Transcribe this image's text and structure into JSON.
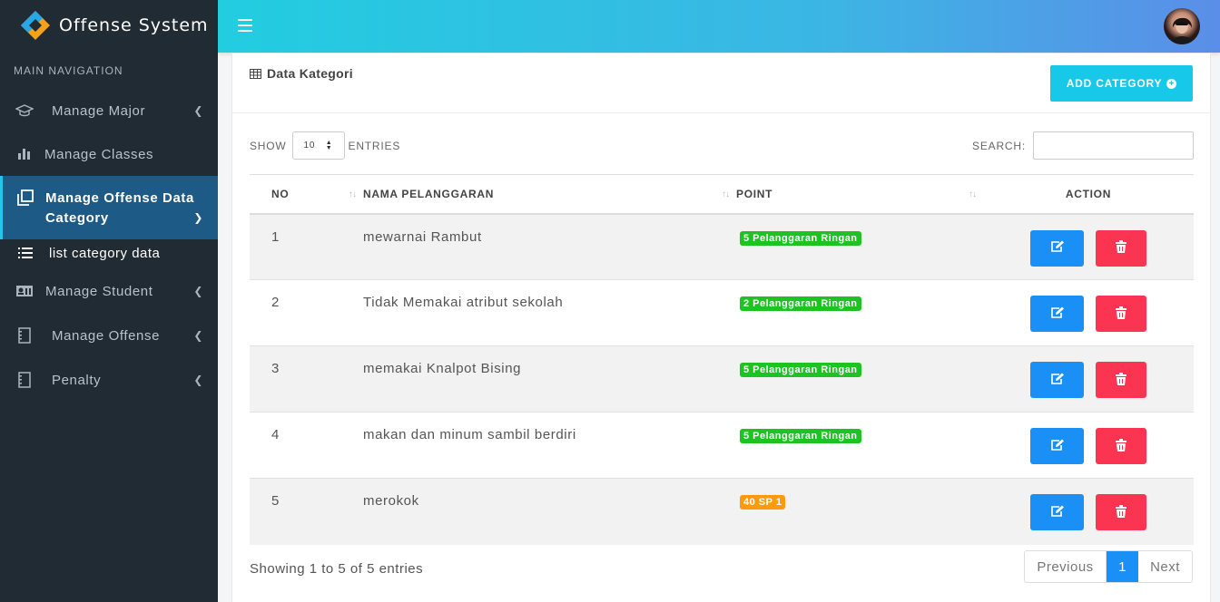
{
  "app": {
    "title": "Offense System"
  },
  "sidebar": {
    "header": "MAIN NAVIGATION",
    "items": [
      {
        "label": "Manage Major",
        "icon": "graduation-cap-icon"
      },
      {
        "label": "Manage Classes",
        "icon": "bar-chart-icon"
      },
      {
        "label": "Manage Offense Data Category",
        "icon": "copy-icon"
      },
      {
        "label": "Manage Student",
        "icon": "id-card-icon"
      },
      {
        "label": "Manage Offense",
        "icon": "notebook-icon"
      },
      {
        "label": "Penalty",
        "icon": "notebook-icon"
      }
    ],
    "subitem": {
      "label": "list category data",
      "icon": "list-icon"
    }
  },
  "card": {
    "title": "Data Kategori",
    "add_button": "ADD CATEGORY",
    "show_label": "SHOW",
    "entries_label": "ENTRIES",
    "entries_value": "10",
    "search_label": "SEARCH:",
    "search_value": ""
  },
  "table": {
    "headers": [
      "NO",
      "NAMA PELANGGARAN",
      "POINT",
      "ACTION"
    ],
    "rows": [
      {
        "no": "1",
        "nama": "mewarnai Rambut",
        "point": "5 Pelanggaran Ringan",
        "color": "green"
      },
      {
        "no": "2",
        "nama": "Tidak Memakai atribut sekolah",
        "point": "2 Pelanggaran Ringan",
        "color": "green"
      },
      {
        "no": "3",
        "nama": "memakai Knalpot Bising",
        "point": "5 Pelanggaran Ringan",
        "color": "green"
      },
      {
        "no": "4",
        "nama": "makan dan minum sambil berdiri",
        "point": "5 Pelanggaran Ringan",
        "color": "green"
      },
      {
        "no": "5",
        "nama": "merokok",
        "point": "40 SP 1",
        "color": "orange"
      }
    ]
  },
  "footer": {
    "info": "Showing 1 to 5 of 5 entries",
    "prev": "Previous",
    "page": "1",
    "next": "Next"
  },
  "colors": {
    "accent": "#18c8e8",
    "edit": "#1a8ff5",
    "delete": "#fb3551",
    "sidebar": "#212b33",
    "active": "#1e5a86"
  }
}
